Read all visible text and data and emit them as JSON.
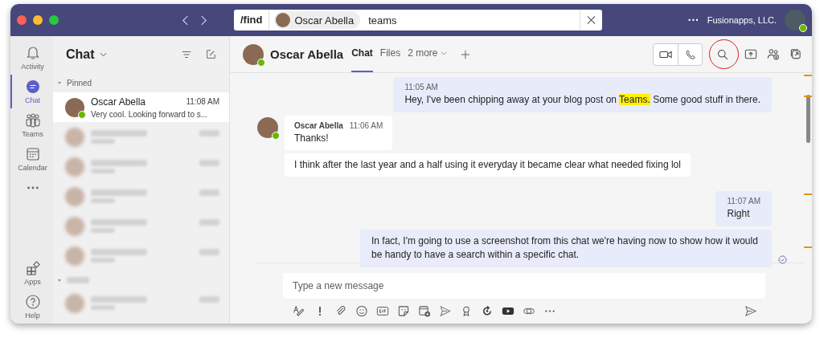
{
  "title_bar": {
    "command": "/find",
    "chip": {
      "name": "Oscar Abella"
    },
    "query": "teams",
    "org": "Fusionapps, LLC.",
    "more": "···"
  },
  "rail": [
    {
      "kind": "activity",
      "label": "Activity",
      "selected": false
    },
    {
      "kind": "chat",
      "label": "Chat",
      "selected": true
    },
    {
      "kind": "teams",
      "label": "Teams",
      "selected": false
    },
    {
      "kind": "calendar",
      "label": "Calendar",
      "selected": false
    },
    {
      "kind": "more",
      "selected": false
    },
    {
      "kind": "apps",
      "label": "Apps",
      "selected": false
    },
    {
      "kind": "help",
      "label": "Help",
      "selected": false
    }
  ],
  "chat_list": {
    "title": "Chat",
    "sections": [
      {
        "kind": "named",
        "title": "Pinned",
        "items": [
          {
            "kind": "contact",
            "name": "Oscar Abella",
            "time": "11:08 AM",
            "preview": "Very cool. Looking forward to s...",
            "selected": true
          },
          {
            "kind": "blurred",
            "selected": false
          },
          {
            "kind": "blurred",
            "selected": false
          },
          {
            "kind": "blurred",
            "selected": false
          },
          {
            "kind": "blurred",
            "selected": false
          },
          {
            "kind": "blurred",
            "selected": false
          }
        ]
      },
      {
        "kind": "blurred",
        "items": [
          {
            "kind": "blurred",
            "selected": false
          }
        ]
      }
    ]
  },
  "conversation": {
    "name": "Oscar Abella",
    "tabs": [
      {
        "label": "Chat",
        "selected": true
      },
      {
        "label": "Files",
        "selected": false
      },
      {
        "label": "2 more",
        "selected": false
      }
    ],
    "messages": [
      {
        "kind": "mine",
        "time": "11:05 AM",
        "parts": [
          {
            "text": "Hey, I've been chipping away at your blog post on ",
            "highlight": false
          },
          {
            "text": "Teams.",
            "highlight": true
          },
          {
            "text": " Some good stuff in there.",
            "highlight": false
          }
        ]
      },
      {
        "kind": "theirs",
        "sender": "Oscar Abella",
        "time": "11:06 AM",
        "parts": [
          {
            "text": "Thanks!",
            "highlight": false
          }
        ]
      },
      {
        "kind": "theirs_more",
        "parts": [
          {
            "text": "I think after the last year and a half using it everyday it became clear what needed fixing lol",
            "highlight": false
          }
        ]
      },
      {
        "kind": "mine",
        "time": "11:07 AM",
        "parts": [
          {
            "text": "Right",
            "highlight": false
          }
        ]
      },
      {
        "kind": "mine_more",
        "read": true,
        "parts": [
          {
            "text": "In fact, I'm going to use a screenshot from this chat we're having now to show how it would be handy to have a search within a specific chat.",
            "highlight": false
          }
        ]
      }
    ],
    "composer": {
      "placeholder": "Type a new message"
    }
  }
}
